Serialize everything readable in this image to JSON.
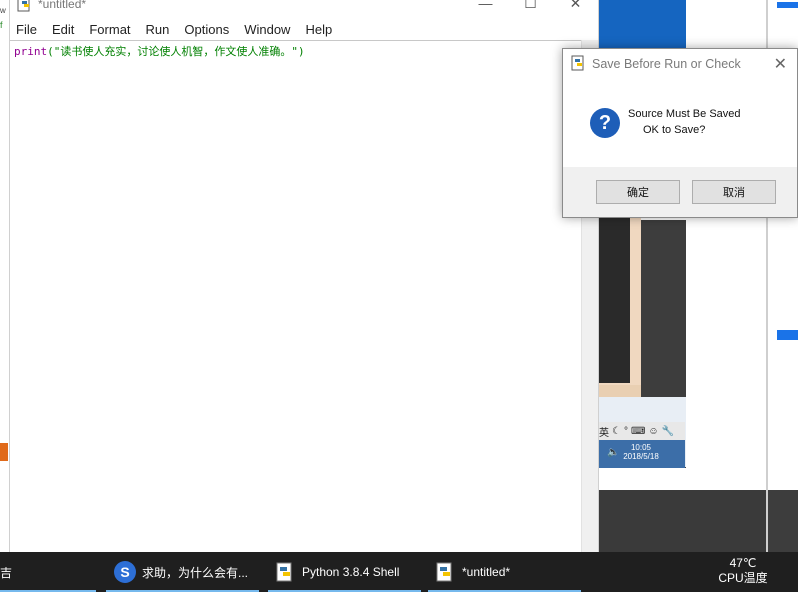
{
  "editor": {
    "title": "*untitled*",
    "window_controls": {
      "minimize": "—",
      "maximize": "☐",
      "close": "✕"
    },
    "menu": [
      "File",
      "Edit",
      "Format",
      "Run",
      "Options",
      "Window",
      "Help"
    ],
    "code": {
      "keyword": "print",
      "rest": "(\"读书使人充实，讨论使人机智，作文使人准确。\")"
    }
  },
  "dialog": {
    "title": "Save Before Run or Check",
    "close_glyph": "✕",
    "icon": "question-icon",
    "icon_glyph": "?",
    "message_line1": "Source Must Be Saved",
    "message_line2": "OK to Save?",
    "ok_label": "确定",
    "cancel_label": "取消"
  },
  "background": {
    "mini_tray_label": "英",
    "mini_clock_time": "10:05",
    "mini_clock_date": "2018/5/18"
  },
  "taskbar": {
    "left_char": "吉",
    "items": [
      {
        "label": "求助，为什么会有...",
        "icon": "sogou-icon"
      },
      {
        "label": "Python 3.8.4 Shell",
        "icon": "python-idle-icon"
      },
      {
        "label": "*untitled*",
        "icon": "python-idle-icon"
      }
    ],
    "temp_line1": "47℃",
    "temp_line2": "CPU温度"
  },
  "colors": {
    "keyword": "#900090",
    "string": "#008000",
    "taskbar": "#1f1f1f",
    "accent": "#76b9ed",
    "question": "#1e5eb8"
  }
}
